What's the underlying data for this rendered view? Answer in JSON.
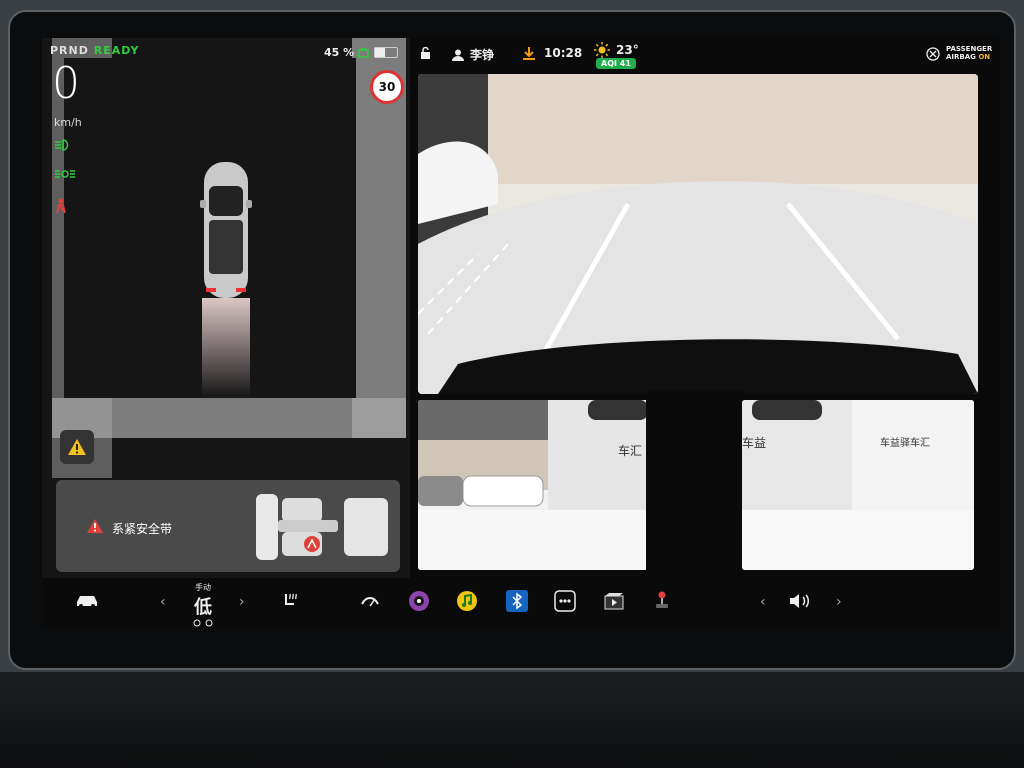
{
  "status_left": {
    "gear": "PRND",
    "ready": "READY",
    "battery_percent": "45 %",
    "battery_level": 0.45,
    "speed": "0",
    "speed_unit": "km/h",
    "speed_limit": "30"
  },
  "status_right": {
    "driver": "李铮",
    "time": "10:28",
    "temperature": "23°",
    "aqi": "AQI 41",
    "airbag_line1": "PASSENGER",
    "airbag_line2": "AIRBAG",
    "airbag_state": "ON"
  },
  "alert": {
    "message": "系紧安全带"
  },
  "camera_signs": {
    "left": "车汇",
    "right_small": "车益",
    "right_wall": "车益驿车汇"
  },
  "climate": {
    "mode_label": "手动",
    "fan_level": "低"
  },
  "dock": {
    "icons": [
      "car-icon",
      "chevron-left-icon",
      "chevron-right-icon",
      "seat-heater-icon",
      "wiper-icon",
      "media-icon",
      "music-icon",
      "bluetooth-icon",
      "more-apps-icon",
      "video-icon",
      "joystick-icon",
      "volume-icon"
    ]
  },
  "colors": {
    "ready_green": "#2ecc40",
    "alert_red": "#e0403a",
    "airbag_on": "#f3b028",
    "aqi_green": "#1fae4b"
  }
}
